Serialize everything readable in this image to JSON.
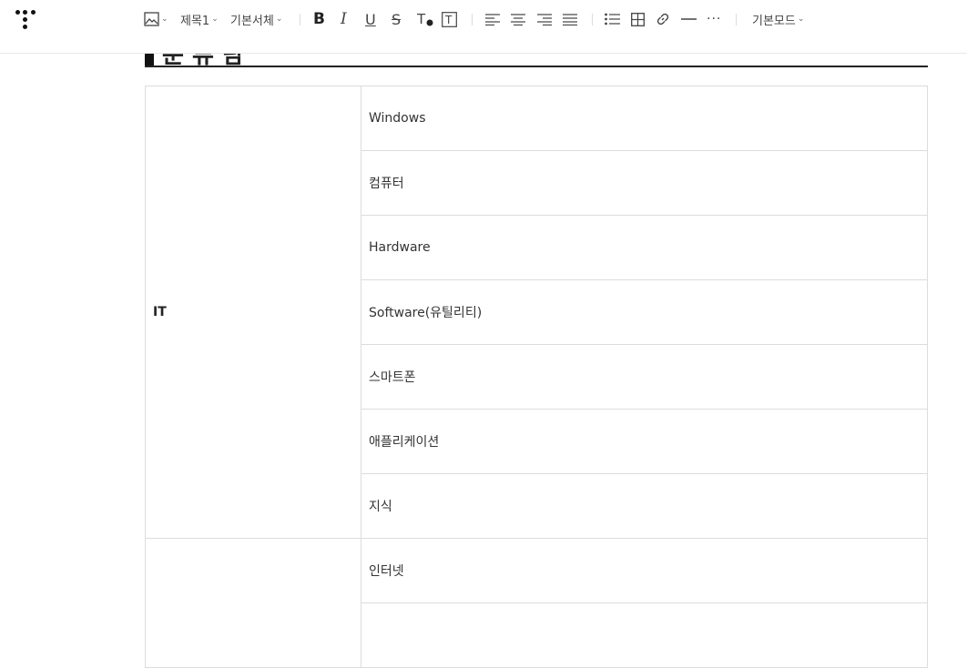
{
  "toolbar": {
    "heading_select": "제목1",
    "font_select": "기본서체",
    "mode_select": "기본모드",
    "more": "···"
  },
  "heading": {
    "text": "분 류 탐"
  },
  "table": {
    "groups": [
      {
        "main": "IT",
        "subs": [
          "Windows",
          "컴퓨터",
          "Hardware",
          "Software(유틸리티)",
          "스마트폰",
          "애플리케이션",
          "지식"
        ]
      },
      {
        "main": "",
        "subs": [
          "인터넷"
        ]
      }
    ]
  }
}
